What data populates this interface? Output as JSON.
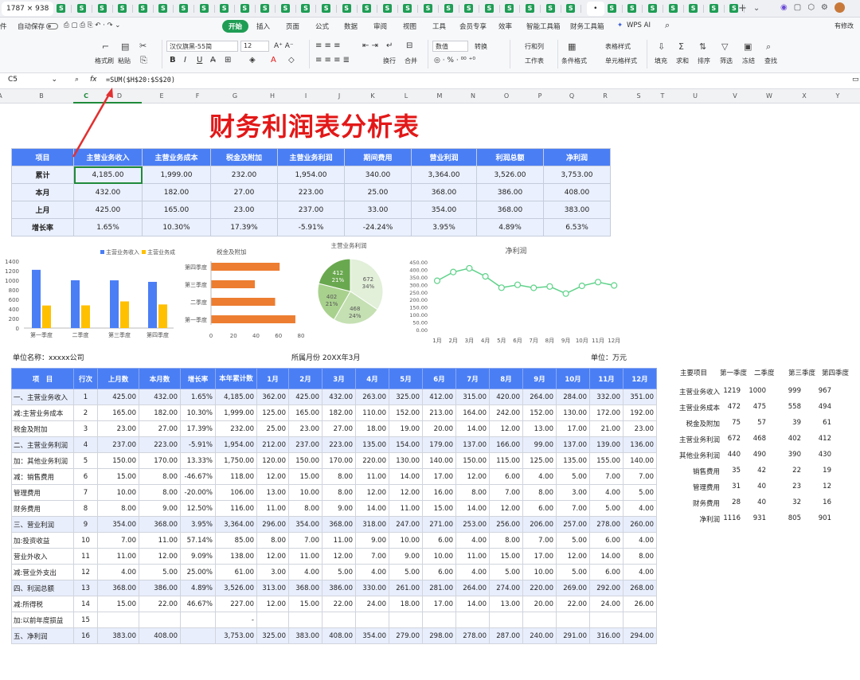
{
  "window": {
    "tab_active": "1787 × 938",
    "sheet_tab_glyph": "S",
    "add_tab": "+",
    "tab_menu": "⌄"
  },
  "menubar": {
    "file_stub": "件",
    "autosave": "自动保存",
    "tabs": [
      "开始",
      "插入",
      "页面",
      "公式",
      "数据",
      "审阅",
      "视图",
      "工具",
      "会员专享",
      "效率",
      "智能工具箱",
      "财务工具箱",
      "WPS AI"
    ],
    "right_text": "有修改"
  },
  "ribbon": {
    "format_painter": "格式刷",
    "paste": "粘贴",
    "font_name": "汉仪旗黑-55简",
    "font_size": "12",
    "number_format": "数值",
    "convert": "转换",
    "row_col": "行和列",
    "worksheet": "工作表",
    "table_style": "表格样式",
    "cond_format": "条件格式",
    "cell_style": "单元格样式",
    "wrap": "换行",
    "merge": "合并",
    "fill": "填充",
    "sum": "求和",
    "sort": "排序",
    "filter": "筛选",
    "freeze": "冻结",
    "find": "查找"
  },
  "formula_bar": {
    "cell_ref": "C5",
    "fx": "fx",
    "formula": "=SUM($H$20:$S$20)"
  },
  "columns": [
    "A",
    "B",
    "C",
    "D",
    "E",
    "F",
    "G",
    "H",
    "I",
    "J",
    "K",
    "L",
    "M",
    "N",
    "O",
    "P",
    "Q",
    "R",
    "S",
    "T",
    "U",
    "V",
    "W",
    "X",
    "Y"
  ],
  "colors": {
    "accent_green": "#1f9d55",
    "header_blue": "#4a7ef5",
    "title_red": "#e31818",
    "bar_blue": "#4a7ef5",
    "bar_yellow": "#ffc000",
    "hbar_orange": "#ed7d31",
    "line_green": "#5fd28a"
  },
  "title": "财务利润表分析表",
  "summary": {
    "headers": [
      "项目",
      "主营业务收入",
      "主营业务成本",
      "税金及附加",
      "主营业务利润",
      "期间费用",
      "营业利润",
      "利润总额",
      "净利润"
    ],
    "rows": [
      [
        "累计",
        "4,185.00",
        "1,999.00",
        "232.00",
        "1,954.00",
        "340.00",
        "3,364.00",
        "3,526.00",
        "3,753.00"
      ],
      [
        "本月",
        "432.00",
        "182.00",
        "27.00",
        "223.00",
        "25.00",
        "368.00",
        "386.00",
        "408.00"
      ],
      [
        "上月",
        "425.00",
        "165.00",
        "23.00",
        "237.00",
        "33.00",
        "354.00",
        "368.00",
        "383.00"
      ],
      [
        "增长率",
        "1.65%",
        "10.30%",
        "17.39%",
        "-5.91%",
        "-24.24%",
        "3.95%",
        "4.89%",
        "6.53%"
      ]
    ]
  },
  "chart_data": [
    {
      "type": "bar",
      "categories": [
        "第一季度",
        "二季度",
        "第三季度",
        "第四季度"
      ],
      "series": [
        {
          "name": "主营业务收入",
          "values": [
            1219,
            1000,
            999,
            967
          ]
        },
        {
          "name": "主营业务成本",
          "values": [
            472,
            475,
            558,
            494
          ]
        }
      ],
      "legend_labels": [
        "主营业务收入",
        "主营业务成"
      ],
      "ylim": [
        0,
        1400
      ],
      "yticks": [
        "0",
        "200",
        "400",
        "600",
        "800",
        "1000",
        "1200",
        "1400"
      ]
    },
    {
      "type": "bar",
      "orientation": "horizontal",
      "title": "税金及附加",
      "categories": [
        "第一季度",
        "二季度",
        "第三季度",
        "第四季度"
      ],
      "values": [
        75,
        57,
        39,
        61
      ],
      "xlim": [
        0,
        80
      ],
      "xticks": [
        "0",
        "20",
        "40",
        "60",
        "80"
      ]
    },
    {
      "type": "pie",
      "title": "主营业务利润",
      "slices": [
        {
          "label": "672\n34%",
          "value": 672,
          "color": "#e2efd9"
        },
        {
          "label": "468\n24%",
          "value": 468,
          "color": "#c5e0b3"
        },
        {
          "label": "402\n21%",
          "value": 402,
          "color": "#a9d18e"
        },
        {
          "label": "412\n21%",
          "value": 412,
          "color": "#6aa84f"
        }
      ]
    },
    {
      "type": "line",
      "title": "净利润",
      "x": [
        "1月",
        "2月",
        "3月",
        "4月",
        "5月",
        "6月",
        "7月",
        "8月",
        "9月",
        "10月",
        "11月",
        "12月"
      ],
      "values": [
        325,
        383,
        408,
        354,
        279,
        298,
        278,
        287,
        240,
        291,
        316,
        294
      ],
      "ylim": [
        0,
        450
      ],
      "yticks": [
        "0.00",
        "50.00",
        "100.00",
        "150.00",
        "200.00",
        "250.00",
        "300.00",
        "350.00",
        "400.00",
        "450.00"
      ]
    }
  ],
  "meta": {
    "company": "单位名称：xxxxx公司",
    "period": "所属月份 20XX年3月",
    "unit": "单位：万元"
  },
  "detail": {
    "headers": [
      "项　目",
      "行次",
      "上月数",
      "本月数",
      "增长率",
      "本年累计数",
      "1月",
      "2月",
      "3月",
      "4月",
      "5月",
      "6月",
      "7月",
      "8月",
      "9月",
      "10月",
      "11月",
      "12月"
    ],
    "rows": [
      [
        "一、主营业务收入",
        "1",
        "425.00",
        "432.00",
        "1.65%",
        "4,185.00",
        "362.00",
        "425.00",
        "432.00",
        "263.00",
        "325.00",
        "412.00",
        "315.00",
        "420.00",
        "264.00",
        "284.00",
        "332.00",
        "351.00"
      ],
      [
        "减:主营业务成本",
        "2",
        "165.00",
        "182.00",
        "10.30%",
        "1,999.00",
        "125.00",
        "165.00",
        "182.00",
        "110.00",
        "152.00",
        "213.00",
        "164.00",
        "242.00",
        "152.00",
        "130.00",
        "172.00",
        "192.00"
      ],
      [
        "税金及附加",
        "3",
        "23.00",
        "27.00",
        "17.39%",
        "232.00",
        "25.00",
        "23.00",
        "27.00",
        "18.00",
        "19.00",
        "20.00",
        "14.00",
        "12.00",
        "13.00",
        "17.00",
        "21.00",
        "23.00"
      ],
      [
        "二、主营业务利润",
        "4",
        "237.00",
        "223.00",
        "-5.91%",
        "1,954.00",
        "212.00",
        "237.00",
        "223.00",
        "135.00",
        "154.00",
        "179.00",
        "137.00",
        "166.00",
        "99.00",
        "137.00",
        "139.00",
        "136.00"
      ],
      [
        "加：其他业务利润",
        "5",
        "150.00",
        "170.00",
        "13.33%",
        "1,750.00",
        "120.00",
        "150.00",
        "170.00",
        "220.00",
        "130.00",
        "140.00",
        "150.00",
        "115.00",
        "125.00",
        "135.00",
        "155.00",
        "140.00"
      ],
      [
        "减：销售费用",
        "6",
        "15.00",
        "8.00",
        "-46.67%",
        "118.00",
        "12.00",
        "15.00",
        "8.00",
        "11.00",
        "14.00",
        "17.00",
        "12.00",
        "6.00",
        "4.00",
        "5.00",
        "7.00",
        "7.00"
      ],
      [
        "管理费用",
        "7",
        "10.00",
        "8.00",
        "-20.00%",
        "106.00",
        "13.00",
        "10.00",
        "8.00",
        "12.00",
        "12.00",
        "16.00",
        "8.00",
        "7.00",
        "8.00",
        "3.00",
        "4.00",
        "5.00"
      ],
      [
        "财务费用",
        "8",
        "8.00",
        "9.00",
        "12.50%",
        "116.00",
        "11.00",
        "8.00",
        "9.00",
        "14.00",
        "11.00",
        "15.00",
        "14.00",
        "12.00",
        "6.00",
        "7.00",
        "5.00",
        "4.00"
      ],
      [
        "三、营业利润",
        "9",
        "354.00",
        "368.00",
        "3.95%",
        "3,364.00",
        "296.00",
        "354.00",
        "368.00",
        "318.00",
        "247.00",
        "271.00",
        "253.00",
        "256.00",
        "206.00",
        "257.00",
        "278.00",
        "260.00"
      ],
      [
        "加:投资收益",
        "10",
        "7.00",
        "11.00",
        "57.14%",
        "85.00",
        "8.00",
        "7.00",
        "11.00",
        "9.00",
        "10.00",
        "6.00",
        "4.00",
        "8.00",
        "7.00",
        "5.00",
        "6.00",
        "4.00"
      ],
      [
        "营业外收入",
        "11",
        "11.00",
        "12.00",
        "9.09%",
        "138.00",
        "12.00",
        "11.00",
        "12.00",
        "7.00",
        "9.00",
        "10.00",
        "11.00",
        "15.00",
        "17.00",
        "12.00",
        "14.00",
        "8.00"
      ],
      [
        "减:营业外支出",
        "12",
        "4.00",
        "5.00",
        "25.00%",
        "61.00",
        "3.00",
        "4.00",
        "5.00",
        "4.00",
        "5.00",
        "6.00",
        "4.00",
        "5.00",
        "10.00",
        "5.00",
        "6.00",
        "4.00"
      ],
      [
        "四、利润总额",
        "13",
        "368.00",
        "386.00",
        "4.89%",
        "3,526.00",
        "313.00",
        "368.00",
        "386.00",
        "330.00",
        "261.00",
        "281.00",
        "264.00",
        "274.00",
        "220.00",
        "269.00",
        "292.00",
        "268.00"
      ],
      [
        "减:所得税",
        "14",
        "15.00",
        "22.00",
        "46.67%",
        "227.00",
        "12.00",
        "15.00",
        "22.00",
        "24.00",
        "18.00",
        "17.00",
        "14.00",
        "13.00",
        "20.00",
        "22.00",
        "24.00",
        "26.00"
      ],
      [
        "加:以前年度损益",
        "15",
        "",
        "",
        "",
        "-",
        "",
        "",
        "",
        "",
        "",
        "",
        "",
        "",
        "",
        "",
        "",
        ""
      ],
      [
        "五、净利润",
        "16",
        "383.00",
        "408.00",
        "",
        "3,753.00",
        "325.00",
        "383.00",
        "408.00",
        "354.00",
        "279.00",
        "298.00",
        "278.00",
        "287.00",
        "240.00",
        "291.00",
        "316.00",
        "294.00"
      ]
    ]
  },
  "quarterly": {
    "headers": [
      "主要项目",
      "第一季度",
      "二季度",
      "第三季度",
      "第四季度"
    ],
    "rows": [
      [
        "主营业务收入",
        "1219",
        "1000",
        "999",
        "967"
      ],
      [
        "主营业务成本",
        "472",
        "475",
        "558",
        "494"
      ],
      [
        "税金及附加",
        "75",
        "57",
        "39",
        "61"
      ],
      [
        "主营业务利润",
        "672",
        "468",
        "402",
        "412"
      ],
      [
        "其他业务利润",
        "440",
        "490",
        "390",
        "430"
      ],
      [
        "销售费用",
        "35",
        "42",
        "22",
        "19"
      ],
      [
        "管理费用",
        "31",
        "40",
        "23",
        "12"
      ],
      [
        "财务费用",
        "28",
        "40",
        "32",
        "16"
      ],
      [
        "净利润",
        "1116",
        "931",
        "805",
        "901"
      ]
    ]
  }
}
